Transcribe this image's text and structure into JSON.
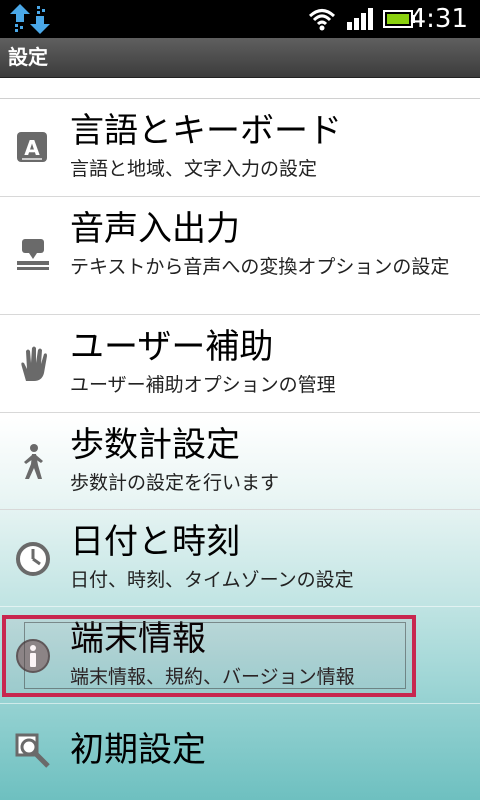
{
  "status_bar": {
    "time": "4:31",
    "icons": [
      "sync-arrows-icon",
      "wifi-icon",
      "signal-icon",
      "battery-icon"
    ]
  },
  "title_bar": {
    "title": "設定"
  },
  "list": {
    "items": [
      {
        "label": "言語とキーボード",
        "sub": "言語と地域、文字入力の設定",
        "icon": "keyboard-a-icon"
      },
      {
        "label": "音声入出力",
        "sub": "テキストから音声への変換オプションの設定",
        "icon": "speech-icon"
      },
      {
        "label": "ユーザー補助",
        "sub": "ユーザー補助オプションの管理",
        "icon": "hand-icon"
      },
      {
        "label": "歩数計設定",
        "sub": "歩数計の設定を行います",
        "icon": "walker-icon"
      },
      {
        "label": "日付と時刻",
        "sub": "日付、時刻、タイムゾーンの設定",
        "icon": "clock-icon"
      },
      {
        "label": "端末情報",
        "sub": "端末情報、規約、バージョン情報",
        "icon": "info-icon"
      },
      {
        "label": "初期設定",
        "icon": "magnifier-icon"
      }
    ]
  },
  "colors": {
    "highlight": "#c8264f",
    "title_bar": "#4a4a4a",
    "list_gradient_end": "#6ec0c0"
  }
}
